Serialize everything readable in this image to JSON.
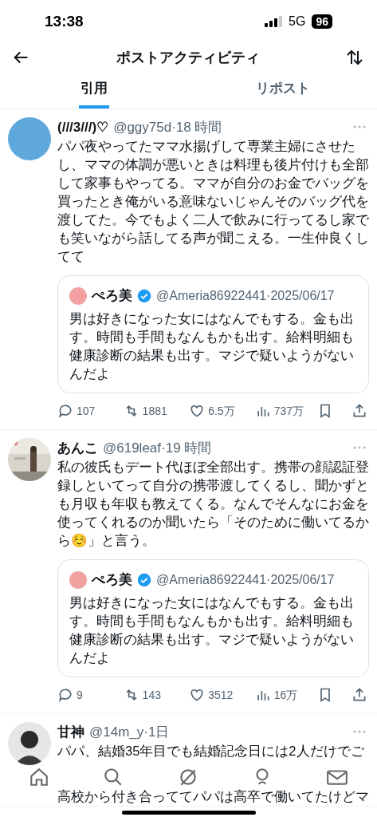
{
  "status_bar": {
    "time": "13:38",
    "network": "5G",
    "battery": "96"
  },
  "header": {
    "title": "ポストアクティビティ"
  },
  "tabs": [
    {
      "label": "引用",
      "selected": true
    },
    {
      "label": "リポスト",
      "selected": false
    }
  ],
  "posts": [
    {
      "name": "(///3///)♡",
      "meta": "@ggy75d·18 時間",
      "avatar": {
        "kind": "plain"
      },
      "text": "パパ夜やってたママ水揚げして専業主婦にさせたし、ママの体調が悪いときは料理も後片付けも全部して家事もやってる。ママが自分のお金でバッグを買ったとき俺がいる意味ないじゃんそのバッグ代を渡してた。今でもよく二人で飲みに行ってるし家でも笑いながら話してる声が聞こえる。一生仲良くしてて",
      "quote": {
        "name": "ぺろ美",
        "verified": true,
        "meta": "@Ameria86922441·2025/06/17",
        "text": "男は好きになった女にはなんでもする。金も出す。時間も手間もなんもかも出す。給料明細も健康診断の結果も出す。マジで疑いようがないんだよ"
      },
      "stats": {
        "replies": "107",
        "reposts": "1881",
        "likes": "6.5万",
        "views": "737万"
      }
    },
    {
      "name": "あんこ",
      "meta": "@619leaf·19 時間",
      "text": "私の彼氏もデート代ほぼ全部出す。携帯の顔認証登録しといてって自分の携帯渡してくるし、聞かずとも月収も年収も教えてくる。なんでそんなにお金を使ってくれるのか聞いたら「そのために働いてるから☺️」と言う。",
      "quote": {
        "name": "ぺろ美",
        "verified": true,
        "meta": "@Ameria86922441·2025/06/17",
        "text": "男は好きになった女にはなんでもする。金も出す。時間も手間もなんもかも出す。給料明細も健康診断の結果も出す。マジで疑いようがないんだよ"
      },
      "stats": {
        "replies": "9",
        "reposts": "143",
        "likes": "3512",
        "views": "16万"
      }
    },
    {
      "name": "甘神",
      "meta": "@14m_y·1日",
      "avatar": {
        "kind": "silhouette"
      },
      "text": "パパ、結婚35年目でも結婚記念日には2人だけでご",
      "text_below_nav": "高校から付き合っててパパは高卒で働いてたけどマ"
    }
  ]
}
